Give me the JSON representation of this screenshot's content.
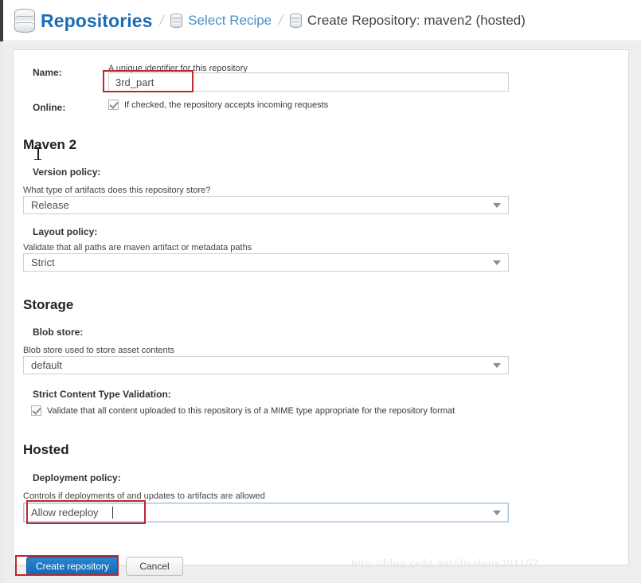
{
  "header": {
    "breadcrumb": {
      "root_label": "Repositories",
      "root_icon": "database-icon",
      "separator": "/",
      "items": [
        {
          "label": "Select Recipe",
          "icon": "database-icon",
          "state": "link"
        },
        {
          "label": "Create Repository: maven2 (hosted)",
          "icon": "database-icon",
          "state": "current"
        }
      ]
    }
  },
  "form": {
    "name": {
      "label": "Name:",
      "help": "A unique identifier for this repository",
      "value": "3rd_part",
      "placeholder": ""
    },
    "online": {
      "label": "Online:",
      "checkbox_label": "If checked, the repository accepts incoming requests",
      "checked": true
    },
    "maven2": {
      "heading": "Maven 2",
      "version_policy": {
        "label": "Version policy:",
        "help": "What type of artifacts does this repository store?",
        "value": "Release"
      },
      "layout_policy": {
        "label": "Layout policy:",
        "help": "Validate that all paths are maven artifact or metadata paths",
        "value": "Strict"
      }
    },
    "storage": {
      "heading": "Storage",
      "blob_store": {
        "label": "Blob store:",
        "help": "Blob store used to store asset contents",
        "value": "default"
      },
      "strict_content_type": {
        "label": "Strict Content Type Validation:",
        "checkbox_label": "Validate that all content uploaded to this repository is of a MIME type appropriate for the repository format",
        "checked": true
      }
    },
    "hosted": {
      "heading": "Hosted",
      "deployment_policy": {
        "label": "Deployment policy:",
        "help": "Controls if deployments of and updates to artifacts are allowed",
        "value": "Allow redeploy",
        "focused": true
      }
    }
  },
  "footer": {
    "create_label": "Create repository",
    "cancel_label": "Cancel"
  },
  "watermark": {
    "text": "http://blog.csdn.net/disalone201107"
  },
  "colors": {
    "brand_blue": "#1b6cb5",
    "link_blue": "#4a90c4",
    "annotation_red": "#c0272d",
    "primary_button": "#1069b4",
    "panel_bg": "#ffffff",
    "gutter_bg": "#eeeeee"
  }
}
